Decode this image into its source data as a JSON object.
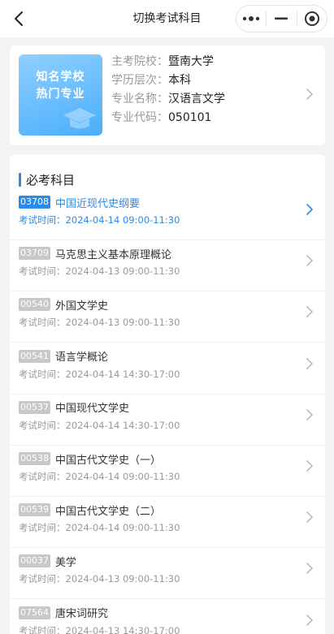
{
  "header": {
    "title": "切换考试科目"
  },
  "school": {
    "thumb_line1": "知名学校",
    "thumb_line2": "热门专业",
    "rows": [
      {
        "label": "主考院校：",
        "value": "暨南大学"
      },
      {
        "label": "学历层次：",
        "value": "本科"
      },
      {
        "label": "专业名称：",
        "value": "汉语言文学"
      },
      {
        "label": "专业代码：",
        "value": "050101"
      }
    ]
  },
  "section": {
    "title": "必考科目"
  },
  "subjects": [
    {
      "code": "03708",
      "name": "中国近现代史纲要",
      "time_label": "考试时间：",
      "time": "2024-04-14 09:00-11:30",
      "active": true
    },
    {
      "code": "03709",
      "name": "马克思主义基本原理概论",
      "time_label": "考试时间：",
      "time": "2024-04-13 09:00-11:30",
      "active": false
    },
    {
      "code": "00540",
      "name": "外国文学史",
      "time_label": "考试时间：",
      "time": "2024-04-13 09:00-11:30",
      "active": false
    },
    {
      "code": "00541",
      "name": "语言学概论",
      "time_label": "考试时间：",
      "time": "2024-04-14 14:30-17:00",
      "active": false
    },
    {
      "code": "00537",
      "name": "中国现代文学史",
      "time_label": "考试时间：",
      "time": "2024-04-14 14:30-17:00",
      "active": false
    },
    {
      "code": "00538",
      "name": "中国古代文学史（一）",
      "time_label": "考试时间：",
      "time": "2024-04-14 09:00-11:30",
      "active": false
    },
    {
      "code": "00539",
      "name": "中国古代文学史（二）",
      "time_label": "考试时间：",
      "time": "2024-04-14 09:00-11:30",
      "active": false
    },
    {
      "code": "00037",
      "name": "美学",
      "time_label": "考试时间：",
      "time": "2024-04-13 09:00-11:30",
      "active": false
    },
    {
      "code": "07564",
      "name": "唐宋词研究",
      "time_label": "考试时间：",
      "time": "2024-04-13 14:30-17:00",
      "active": false
    }
  ],
  "colors": {
    "accent": "#2a8ae8",
    "code_bg": "#c8c8c8",
    "page_bg": "#f2f3f5"
  },
  "icons": {
    "back": "chevron-left-icon",
    "more": "more-dots-icon",
    "minimize": "minimize-icon",
    "close": "target-close-icon",
    "row": "chevron-right-icon"
  }
}
